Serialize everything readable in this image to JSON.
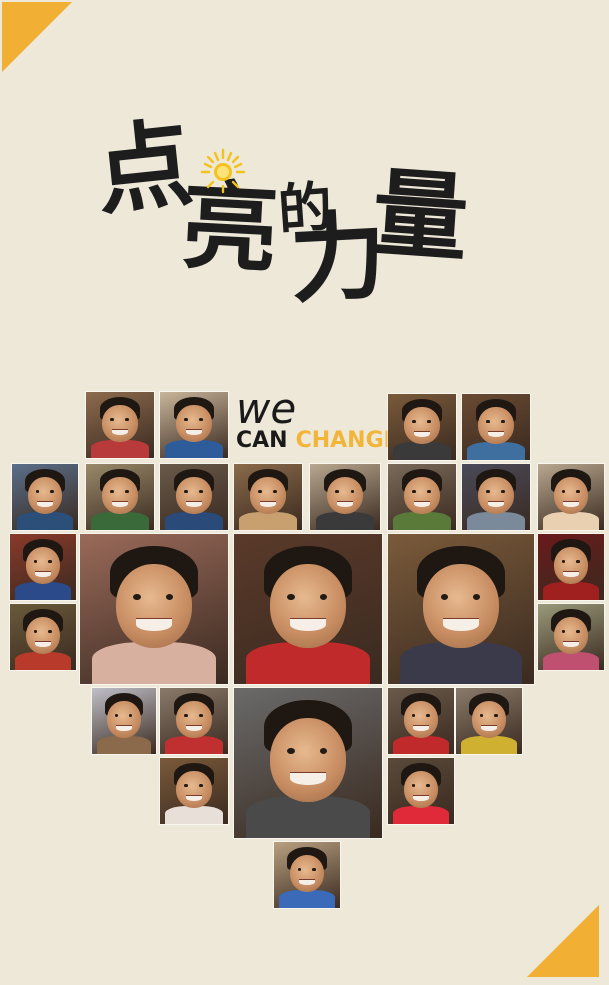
{
  "title": {
    "chars": [
      "点",
      "亮",
      "的",
      "力",
      "量"
    ]
  },
  "slogan": {
    "we": "we",
    "can": "CAN",
    "change": "CHANGE"
  },
  "colors": {
    "background": "#ede8d8",
    "accent": "#f1b033",
    "title_text": "#1d1d1d",
    "change_text": "#f2b53a"
  },
  "icons": {
    "sun": "sun-icon"
  }
}
